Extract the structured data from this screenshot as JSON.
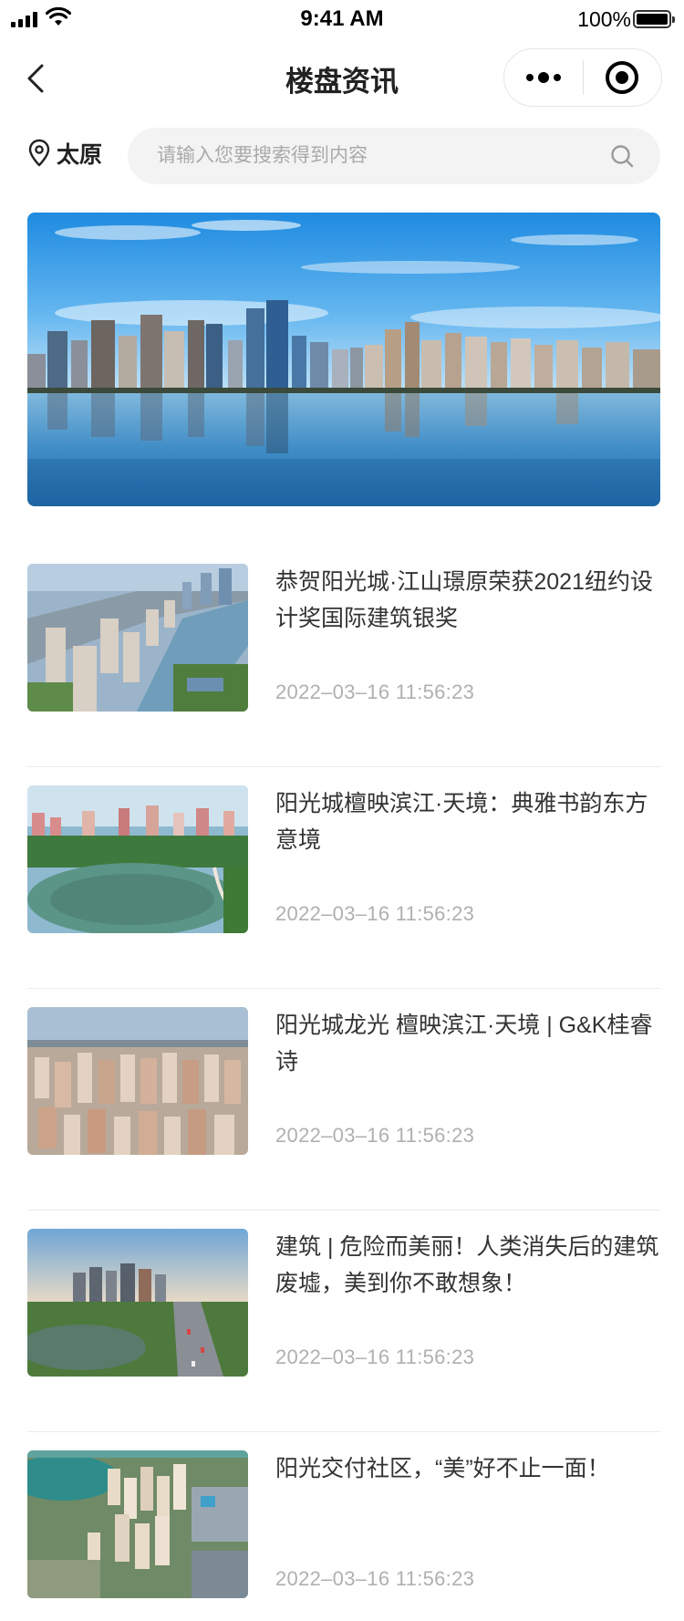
{
  "status_bar": {
    "time": "9:41 AM",
    "battery_percent": "100%",
    "icons": [
      "signal-icon",
      "wifi-icon",
      "battery-icon"
    ]
  },
  "nav": {
    "title": "楼盘资讯",
    "icons": [
      "back-chevron-icon",
      "more-dots-icon",
      "close-target-icon"
    ]
  },
  "search": {
    "city": "太原",
    "placeholder": "请输入您要搜索得到内容",
    "icons": [
      "location-pin-icon",
      "search-icon"
    ]
  },
  "banner": {
    "image": "city-skyline-reflection-photo"
  },
  "news": [
    {
      "title": "恭贺阳光城·江山璟原荣获2021纽约设计奖国际建筑银奖",
      "date": "2022–03–16 11:56:23",
      "thumb": "aerial-city-river-photo"
    },
    {
      "title": "阳光城檀映滨江·天境：典雅书韵东方意境",
      "date": "2022–03–16 11:56:23",
      "thumb": "lake-park-towers-photo"
    },
    {
      "title": "阳光城龙光 檀映滨江·天境 | G&K桂睿诗",
      "date": "2022–03–16 11:56:23",
      "thumb": "dense-residential-aerial-photo"
    },
    {
      "title": "建筑 | 危险而美丽！人类消失后的建筑废墟，美到你不敢想象！",
      "date": "2022–03–16 11:56:23",
      "thumb": "highway-towers-lake-photo"
    },
    {
      "title": "阳光交付社区，“美”好不止一面！",
      "date": "2022–03–16 11:56:23",
      "thumb": "community-towers-aerial-photo"
    }
  ]
}
